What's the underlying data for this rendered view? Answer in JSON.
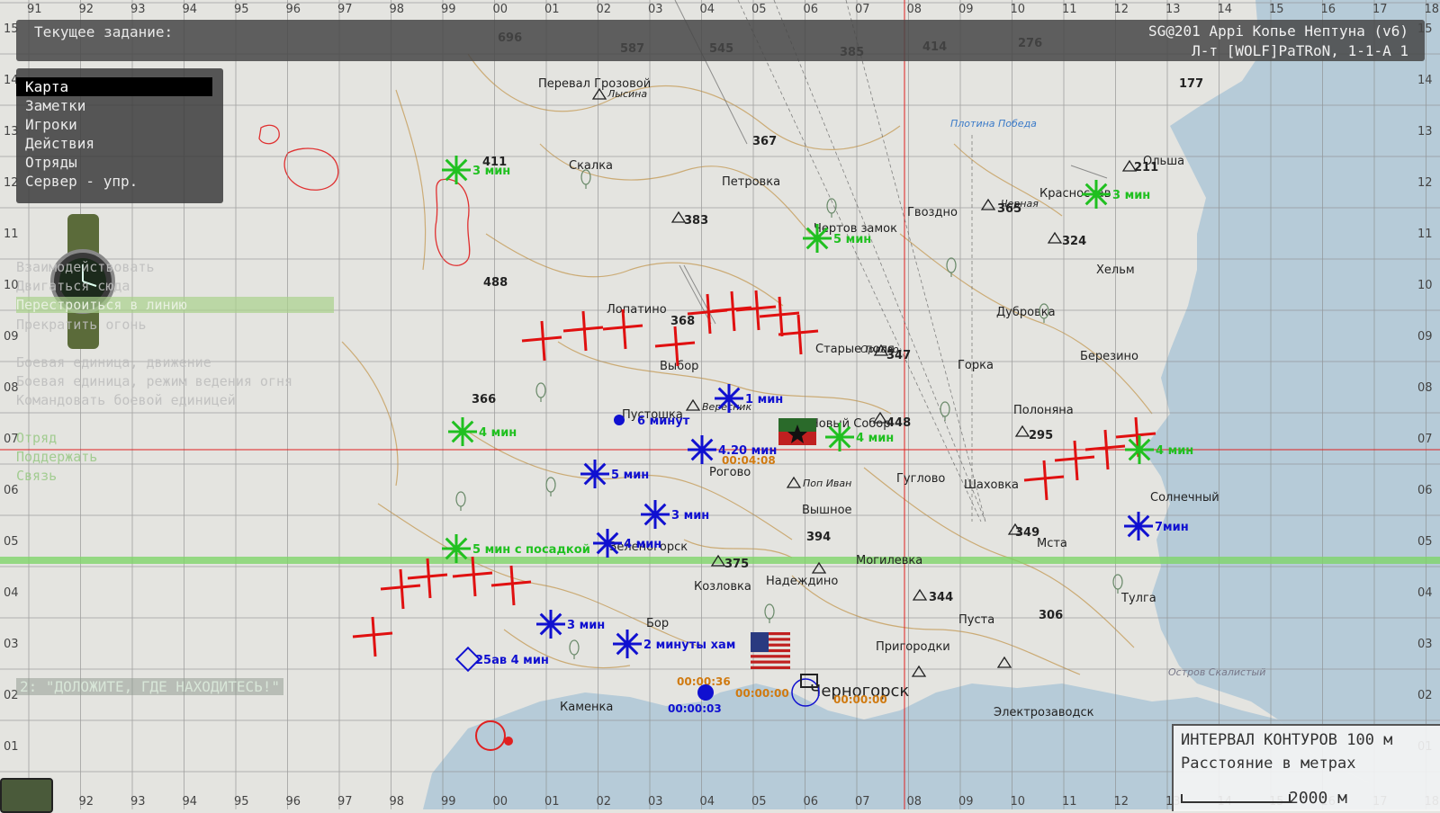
{
  "header": {
    "task_label": "Текущее задание:",
    "mission_title": "SG@201 Appi Копье Нептуна (v6)",
    "player": "Л-т [WOLF]PaTRoN, 1-1-A 1"
  },
  "menu": {
    "items": [
      "Карта",
      "Заметки",
      "Игроки",
      "Действия",
      "Отряды",
      "Сервер - упр."
    ],
    "selected": "Карта"
  },
  "commands": [
    {
      "text": "Взаимодействовать",
      "style": "dim"
    },
    {
      "text": "Двигаться сюда",
      "style": "dim"
    },
    {
      "text": "Перестроиться в линию",
      "style": "hl"
    },
    {
      "text": "Прекратить огонь",
      "style": "dim"
    },
    {
      "text": "Боевая единица, движение",
      "style": "dim"
    },
    {
      "text": "Боевая единица, режим ведения огня",
      "style": "dim"
    },
    {
      "text": "Командовать боевой единицей",
      "style": "dim"
    },
    {
      "text": "Отряд",
      "style": "green"
    },
    {
      "text": "Поддержать",
      "style": "green"
    },
    {
      "text": "Связь",
      "style": "green"
    }
  ],
  "radio_message": "2: \"ДОЛОЖИТЕ, ГДЕ НАХОДИТЕСЬ!\"",
  "legend": {
    "contour": "ИНТЕРВАЛ КОНТУРОВ 100 м",
    "distance": "Расстояние в метрах",
    "scale": "2000 м"
  },
  "grid_x_labels": [
    "91",
    "92",
    "93",
    "94",
    "95",
    "96",
    "97",
    "98",
    "99",
    "00",
    "01",
    "02",
    "03",
    "04",
    "05",
    "06",
    "07",
    "08",
    "09",
    "10",
    "11",
    "12",
    "13",
    "14",
    "15",
    "16",
    "17",
    "18"
  ],
  "grid_y_labels": [
    "15",
    "14",
    "13",
    "12",
    "11",
    "10",
    "09",
    "08",
    "07",
    "06",
    "05",
    "04",
    "03",
    "02",
    "01"
  ],
  "towns": [
    "Перевал Грозовой",
    "Лысина",
    "Скалка",
    "Петровка",
    "Плотина Победа",
    "Ольша",
    "Красностав",
    "Гвоздно",
    "Хельм",
    "Дубровка",
    "Лопатино",
    "Выбор",
    "Старые поля",
    "Горка",
    "Березино",
    "Пустошка",
    "Вересник",
    "Новый Собор",
    "Полоняна",
    "Рогово",
    "Поп Иван",
    "Вышное",
    "Гуглово",
    "Шаховка",
    "Солнечный",
    "Зеленогорск",
    "Мста",
    "Могилевка",
    "Козловка",
    "Надеждино",
    "Тулга",
    "Бор",
    "Пуста",
    "Пригородки",
    "Каменка",
    "Черногорск",
    "Электрозаводск",
    "Остров Скалистый",
    "Орлово",
    "Чертов замок",
    "Черная"
  ],
  "elevations": [
    "696",
    "587",
    "545",
    "385",
    "414",
    "276",
    "177",
    "411",
    "367",
    "383",
    "365",
    "324",
    "488",
    "368",
    "347",
    "366",
    "448",
    "295",
    "394",
    "349",
    "375",
    "344",
    "306",
    "211"
  ],
  "markers": {
    "green": [
      "3 мин",
      "5 мин",
      "4 мин",
      "4 мин",
      "4 мин",
      "5 мин с посадкой",
      "3 мин"
    ],
    "blue": [
      "1 мин",
      "6 минут",
      "4.20 мин",
      "5 мин",
      "3 мин",
      "4 мин",
      "3 мин",
      "2 минуты хам",
      "7мин",
      "25ав 4 мин"
    ],
    "orange": [
      "00:04:08",
      "00:00:36",
      "00:00:03",
      "00:00:00",
      "00:00:00"
    ]
  },
  "colors": {
    "map_bg": "#e4e4e0",
    "sea": "#b6cbd8",
    "grid": "#8a8a8a",
    "contour": "#c9a56a",
    "red": "#e01010",
    "green": "#20c020",
    "blue": "#1010d0",
    "orange": "#d07a10"
  }
}
